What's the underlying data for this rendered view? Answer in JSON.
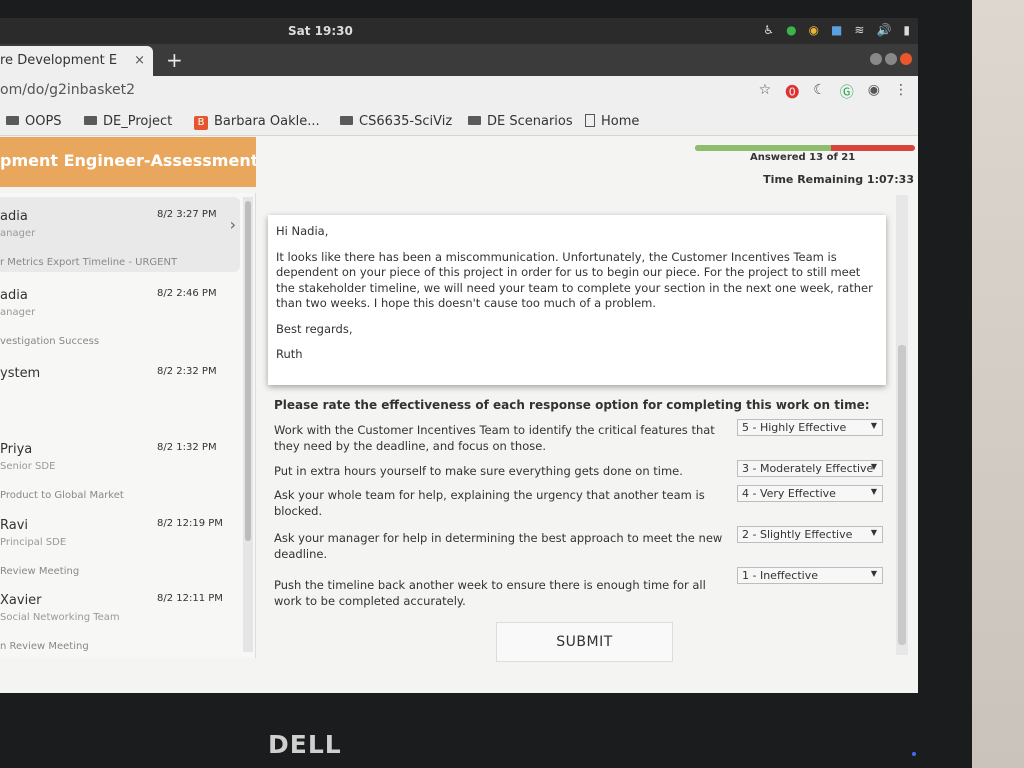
{
  "system": {
    "clock": "Sat 19:30",
    "icons": [
      "accessibility-icon",
      "chevron-down-icon",
      "green-dot-icon",
      "chrome-icon",
      "app-icon",
      "wifi-icon",
      "volume-icon",
      "battery-icon",
      "chevron-down-icon"
    ]
  },
  "browser": {
    "tab_title": "re Development E",
    "tab_close": "×",
    "new_tab": "+",
    "url": "om/do/g2inbasket2",
    "bookmarks": [
      {
        "label": "OOPS",
        "icon": "folder-icon"
      },
      {
        "label": "DE_Project",
        "icon": "folder-icon"
      },
      {
        "label": "Barbara Oakle...",
        "icon": "b-bookmark-icon"
      },
      {
        "label": "CS6635-SciViz",
        "icon": "folder-icon"
      },
      {
        "label": "DE Scenarios",
        "icon": "folder-icon"
      },
      {
        "label": "Home",
        "icon": "page-icon"
      }
    ]
  },
  "header": {
    "banner": "pment Engineer-Assessment",
    "answered": "Answered 13 of 21",
    "answered_fraction": 0.62,
    "time_remaining": "Time Remaining 1:07:33",
    "colors": {
      "banner": "#e8a75c",
      "progress_done": "#8fbd6e",
      "progress_left": "#d8443c"
    }
  },
  "inbox": [
    {
      "name": "adia",
      "role": "anager",
      "subject": "r Metrics Export Timeline - URGENT",
      "date": "8/2 3:27 PM",
      "selected": true
    },
    {
      "name": "adia",
      "role": "anager",
      "subject": "vestigation Success",
      "date": "8/2 2:46 PM"
    },
    {
      "name": "ystem",
      "role": "",
      "subject": "",
      "date": "8/2 2:32 PM"
    },
    {
      "name": "Priya",
      "role": "Senior SDE",
      "subject": " Product to Global Market",
      "date": "8/2 1:32 PM"
    },
    {
      "name": "Ravi",
      "role": "Principal SDE",
      "subject": " Review Meeting",
      "date": "8/2 12:19 PM"
    },
    {
      "name": "Xavier",
      "role": "Social Networking Team",
      "subject": "n Review Meeting",
      "date": "8/2 12:11 PM"
    }
  ],
  "email": {
    "greeting": "Hi Nadia,",
    "body": "It looks like there has been a miscommunication. Unfortunately, the Customer Incentives Team is dependent on your piece of this project in order for us to begin our piece. For the project to still meet the stakeholder timeline, we will need your team to complete your section in the next one week, rather than two weeks. I hope this doesn't cause too much of a problem.",
    "closing": "Best regards,",
    "signature": "Ruth"
  },
  "question": "Please rate the effectiveness of each response option for completing this work on time:",
  "options": [
    {
      "text": "Work with the Customer Incentives Team to identify the critical features that they need by the deadline, and focus on those.",
      "rating": "5 - Highly Effective"
    },
    {
      "text": "Put in extra hours yourself to make sure everything gets done on time.",
      "rating": "3 - Moderately Effective"
    },
    {
      "text": "Ask your whole team for help, explaining the urgency that another team is blocked.",
      "rating": "4 - Very Effective"
    },
    {
      "text": "Ask your manager for help in determining the best approach to meet the new deadline.",
      "rating": "2 - Slightly Effective"
    },
    {
      "text": "Push the timeline back another week to ensure there is enough time for all work to be completed accurately.",
      "rating": "1 - Ineffective"
    }
  ],
  "submit_label": "SUBMIT",
  "monitor_brand": "DELL"
}
